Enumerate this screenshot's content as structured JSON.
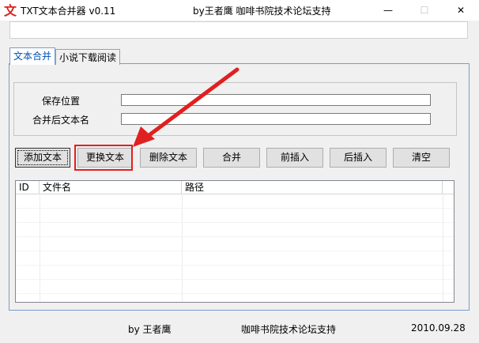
{
  "window": {
    "title": "TXT文本合并器 v0.11",
    "author": "by王者鹰 咖啡书院技术论坛支持",
    "minimize_glyph": "—",
    "maximize_glyph": "☐",
    "close_glyph": "✕"
  },
  "tabs": [
    {
      "label": "文本合并",
      "active": true
    },
    {
      "label": "小说下载阅读",
      "active": false
    }
  ],
  "form": {
    "save_location_label": "保存位置",
    "save_location_value": "",
    "merged_name_label": "合并后文本名",
    "merged_name_value": ""
  },
  "toolbar": {
    "add_text": "添加文本",
    "replace_text": "更换文本",
    "delete_text": "删除文本",
    "merge": "合并",
    "insert_before": "前插入",
    "insert_after": "后插入",
    "clear": "清空"
  },
  "list": {
    "columns": [
      "ID",
      "文件名",
      "路径"
    ],
    "rows": []
  },
  "status": {
    "author": "by 王者鹰",
    "forum": "咖啡书院技术论坛支持",
    "date": "2010.09.28"
  },
  "colors": {
    "highlight": "#e02020",
    "tab_active_text": "#0050b4"
  },
  "icons": {
    "app": "red-text-icon",
    "annotation": "red-arrow-icon"
  }
}
